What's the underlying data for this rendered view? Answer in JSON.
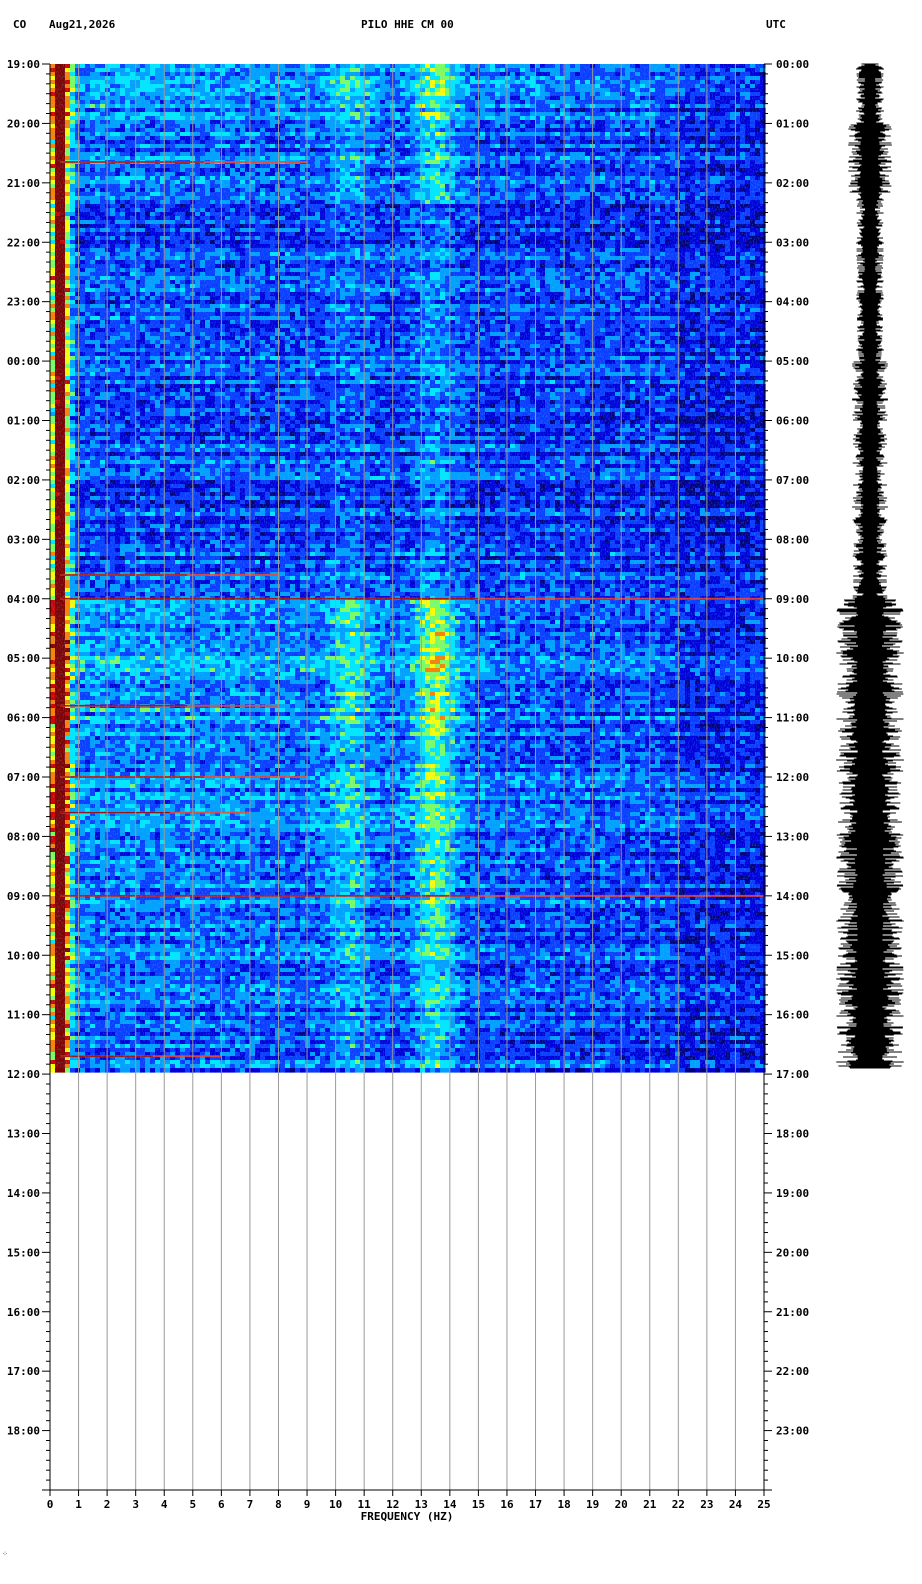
{
  "header": {
    "network": "CO",
    "date": "Aug21,2026",
    "station": "PILO HHE CM 00",
    "timezone": "UTC"
  },
  "chart_data": {
    "type": "heatmap",
    "title": "PILO HHE CM 00",
    "xlabel": "FREQUENCY (HZ)",
    "xlim": [
      0,
      25
    ],
    "x_ticks": [
      "0",
      "1",
      "2",
      "3",
      "4",
      "5",
      "6",
      "7",
      "8",
      "9",
      "10",
      "11",
      "12",
      "13",
      "14",
      "15",
      "16",
      "17",
      "18",
      "19",
      "20",
      "21",
      "22",
      "23",
      "24",
      "25"
    ],
    "left_time_labels": [
      "19:00",
      "20:00",
      "21:00",
      "22:00",
      "23:00",
      "00:00",
      "01:00",
      "02:00",
      "03:00",
      "04:00",
      "05:00",
      "06:00",
      "07:00",
      "08:00",
      "09:00",
      "10:00",
      "11:00",
      "12:00",
      "13:00",
      "14:00",
      "15:00",
      "16:00",
      "17:00",
      "18:00"
    ],
    "right_time_labels": [
      "00:00",
      "01:00",
      "02:00",
      "03:00",
      "04:00",
      "05:00",
      "06:00",
      "07:00",
      "08:00",
      "09:00",
      "10:00",
      "11:00",
      "12:00",
      "13:00",
      "14:00",
      "15:00",
      "16:00",
      "17:00",
      "18:00",
      "19:00",
      "20:00",
      "21:00",
      "22:00",
      "23:00"
    ],
    "hours_total": 24,
    "data_hours": 16.9,
    "grid": "vertical lines at each 1 Hz",
    "colormap": [
      "#000080",
      "#0000d8",
      "#0a3cff",
      "#00a0ff",
      "#00e8ff",
      "#80ff60",
      "#ffff00",
      "#ff8000",
      "#d00000",
      "#800000"
    ],
    "noise_bands": [
      {
        "freq": 0.35,
        "intensity": 1.0
      },
      {
        "freq": 13.5,
        "intensity": 0.55
      },
      {
        "freq": 10.5,
        "intensity": 0.3
      }
    ],
    "event_lines": [
      {
        "hour": 1.65,
        "f_end": 9
      },
      {
        "hour": 8.6,
        "f_end": 8
      },
      {
        "hour": 9.0,
        "f_end": 25
      },
      {
        "hour": 10.8,
        "f_end": 8
      },
      {
        "hour": 12.0,
        "f_end": 9
      },
      {
        "hour": 12.6,
        "f_end": 7
      },
      {
        "hour": 14.0,
        "f_end": 25
      },
      {
        "hour": 16.7,
        "f_end": 6
      }
    ]
  }
}
